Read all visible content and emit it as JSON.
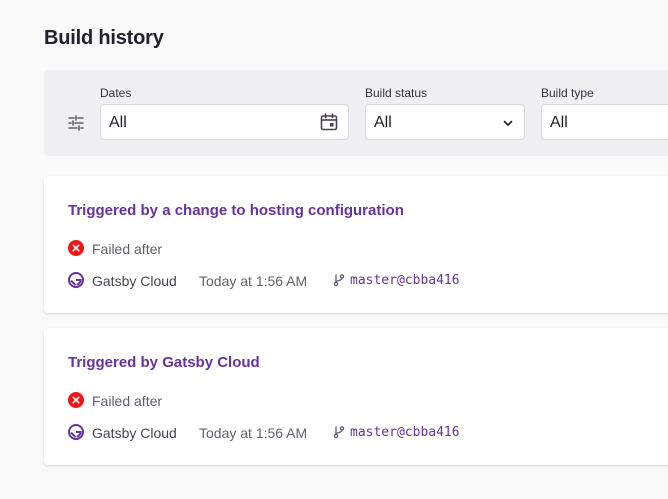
{
  "page": {
    "title": "Build history"
  },
  "filters": {
    "dates": {
      "label": "Dates",
      "value": "All"
    },
    "build_status": {
      "label": "Build status",
      "value": "All"
    },
    "build_type": {
      "label": "Build type",
      "value": "All"
    }
  },
  "builds": [
    {
      "title": "Triggered by a change to hosting configuration",
      "status": "Failed after",
      "source": "Gatsby Cloud",
      "time": "Today at 1:56 AM",
      "branch": "master@cbba416"
    },
    {
      "title": "Triggered by Gatsby Cloud",
      "status": "Failed after",
      "source": "Gatsby Cloud",
      "time": "Today at 1:56 AM",
      "branch": "master@cbba416"
    }
  ],
  "colors": {
    "accent": "#663399",
    "error": "#ec1818",
    "filter_bar": "#f0f0f2",
    "background": "#f9f9f9"
  },
  "icons": {
    "filter": "sliders-icon",
    "calendar": "calendar-icon",
    "chevron": "chevron-down-icon",
    "failed": "error-x-circle-icon",
    "source": "gatsby-logo-icon",
    "branch": "git-branch-icon"
  }
}
